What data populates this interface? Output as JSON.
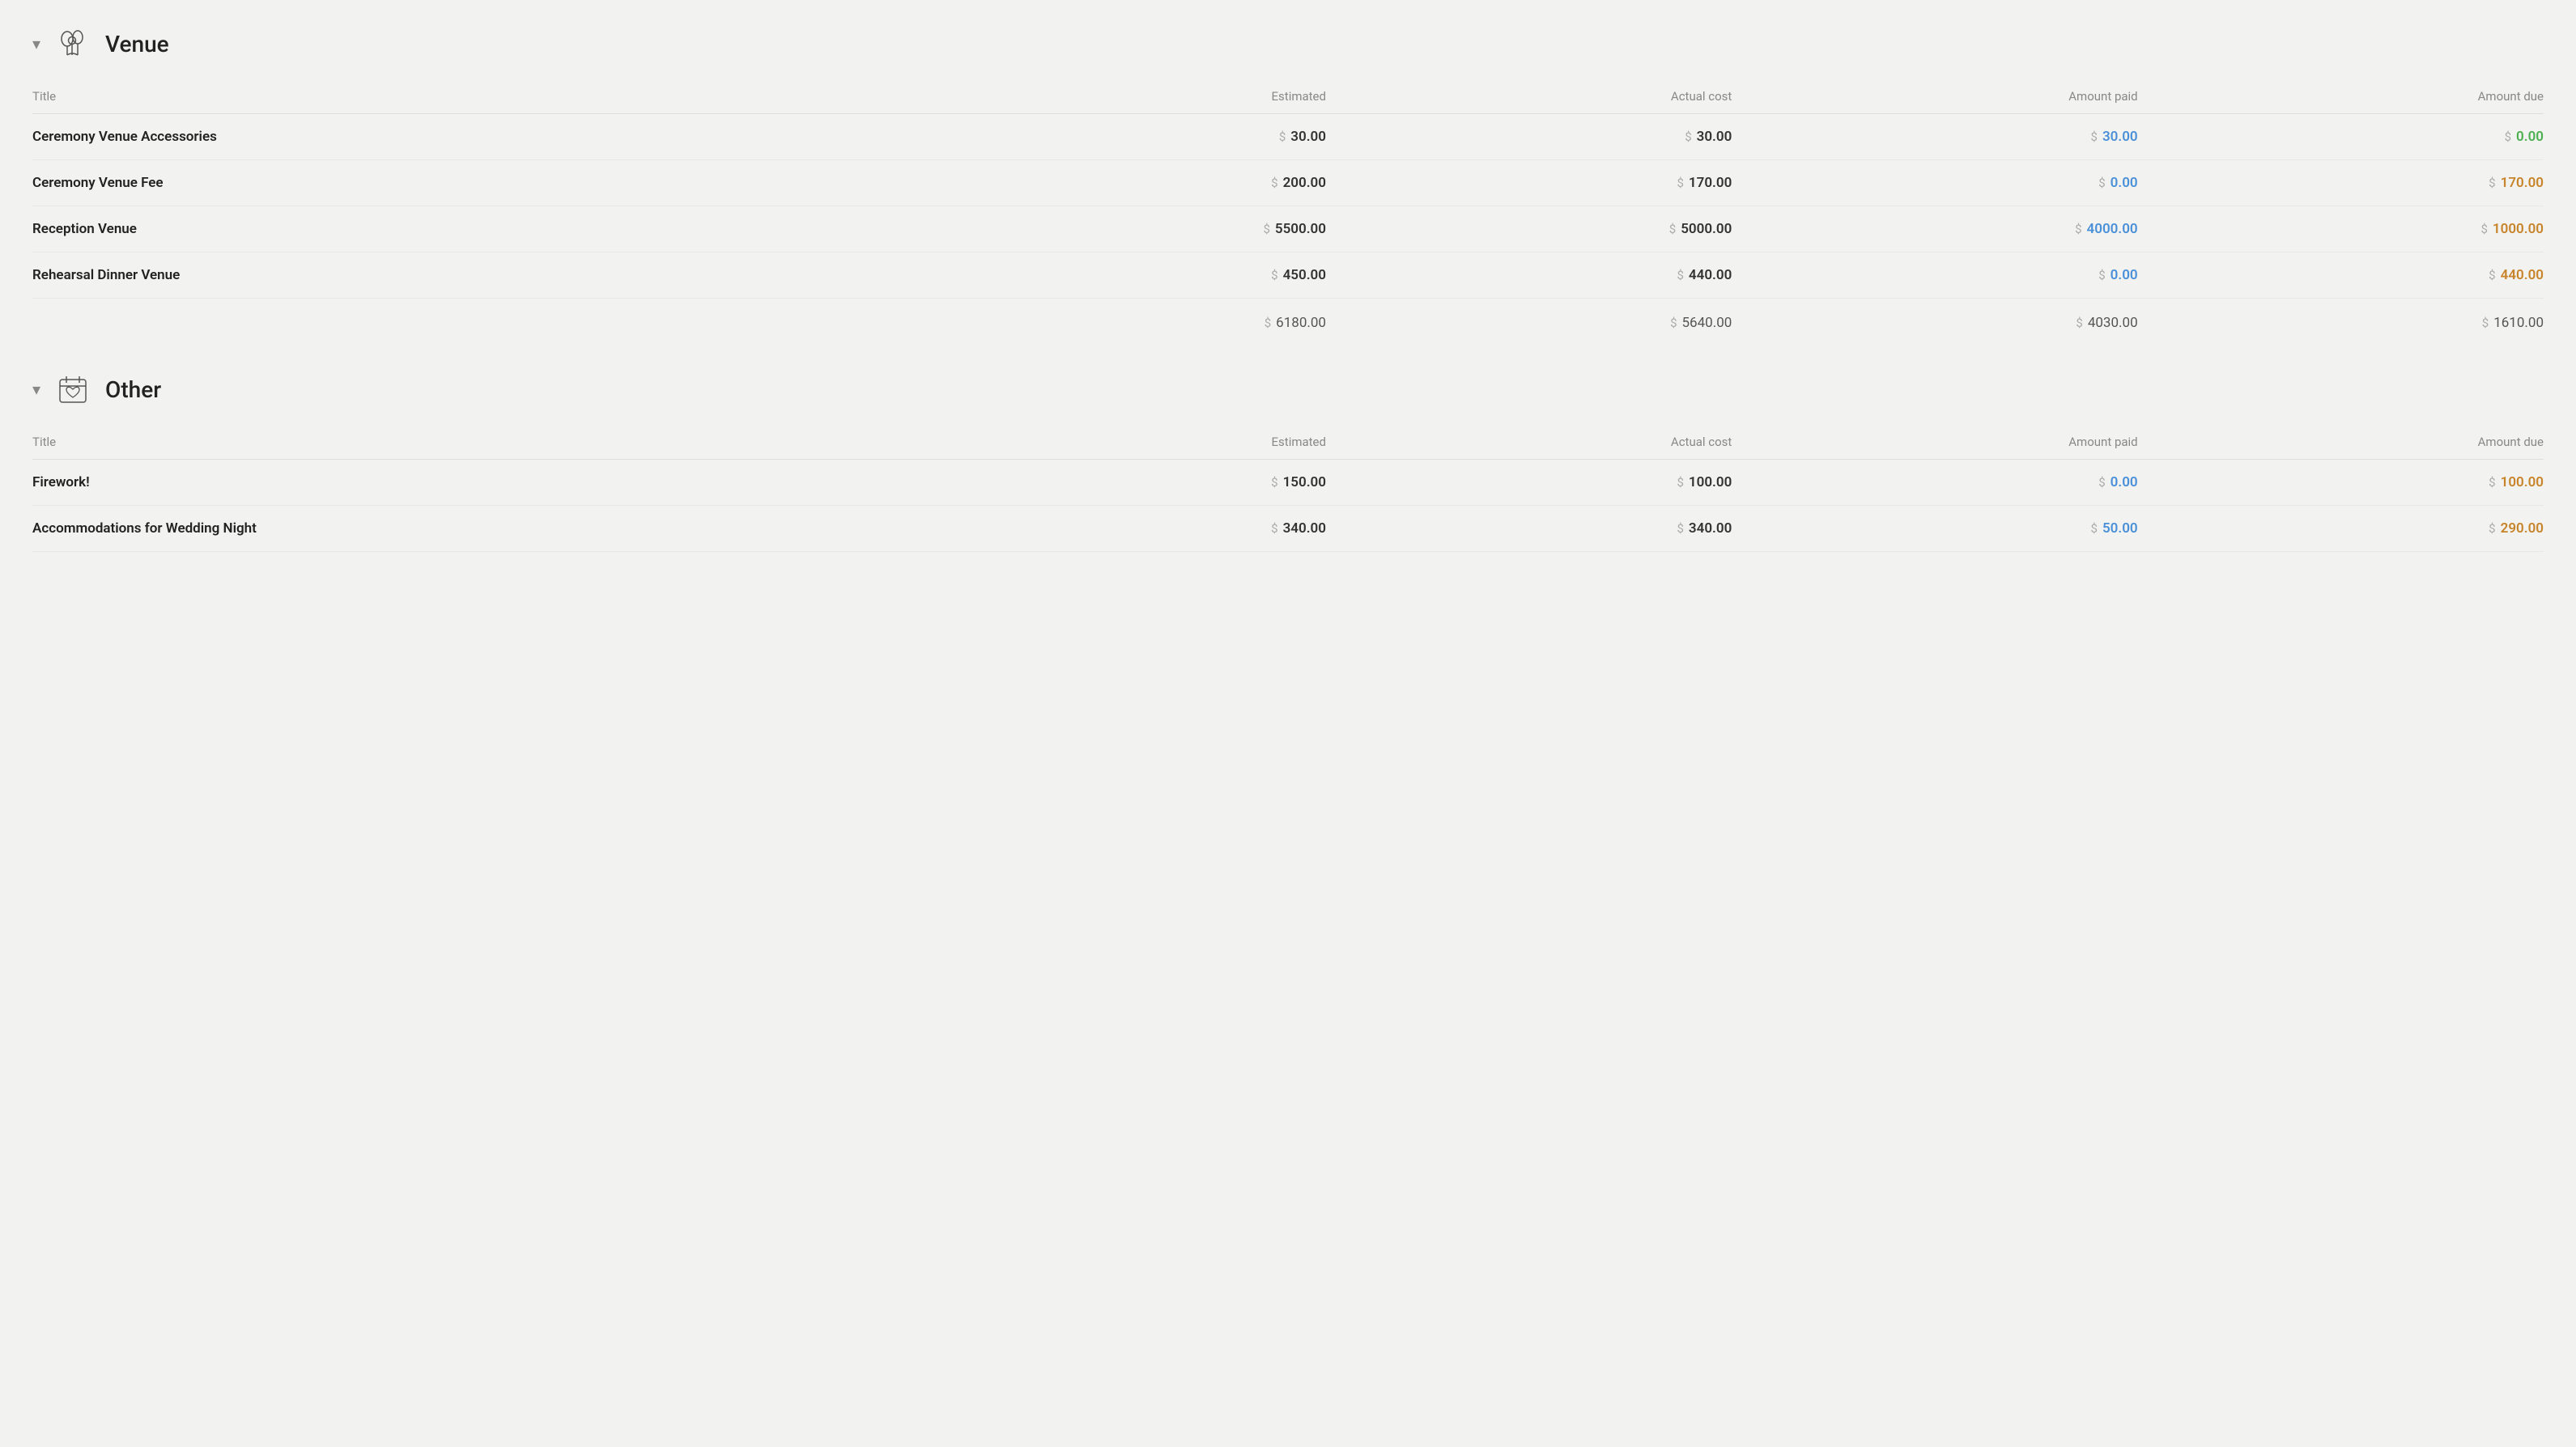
{
  "venue_section": {
    "title": "Venue",
    "chevron": "▾",
    "columns": {
      "title": "Title",
      "estimated": "Estimated",
      "actual_cost": "Actual cost",
      "amount_paid": "Amount paid",
      "amount_due": "Amount due"
    },
    "rows": [
      {
        "title": "Ceremony Venue Accessories",
        "estimated": "30.00",
        "actual_cost": "30.00",
        "amount_paid": "30.00",
        "amount_due": "0.00",
        "paid_zero": false,
        "due_zero": true
      },
      {
        "title": "Ceremony Venue Fee",
        "estimated": "200.00",
        "actual_cost": "170.00",
        "amount_paid": "0.00",
        "amount_due": "170.00",
        "paid_zero": true,
        "due_zero": false
      },
      {
        "title": "Reception Venue",
        "estimated": "5500.00",
        "actual_cost": "5000.00",
        "amount_paid": "4000.00",
        "amount_due": "1000.00",
        "paid_zero": false,
        "due_zero": false
      },
      {
        "title": "Rehearsal Dinner Venue",
        "estimated": "450.00",
        "actual_cost": "440.00",
        "amount_paid": "0.00",
        "amount_due": "440.00",
        "paid_zero": true,
        "due_zero": false
      }
    ],
    "totals": {
      "estimated": "6180.00",
      "actual_cost": "5640.00",
      "amount_paid": "4030.00",
      "amount_due": "1610.00"
    }
  },
  "other_section": {
    "title": "Other",
    "chevron": "▾",
    "columns": {
      "title": "Title",
      "estimated": "Estimated",
      "actual_cost": "Actual cost",
      "amount_paid": "Amount paid",
      "amount_due": "Amount due"
    },
    "rows": [
      {
        "title": "Firework!",
        "estimated": "150.00",
        "actual_cost": "100.00",
        "amount_paid": "0.00",
        "amount_due": "100.00",
        "paid_zero": true,
        "due_zero": false
      },
      {
        "title": "Accommodations for Wedding Night",
        "estimated": "340.00",
        "actual_cost": "340.00",
        "amount_paid": "50.00",
        "amount_due": "290.00",
        "paid_zero": false,
        "due_zero": false
      }
    ]
  },
  "icons": {
    "venue_icon": "balloon",
    "other_icon": "calendar-heart"
  }
}
